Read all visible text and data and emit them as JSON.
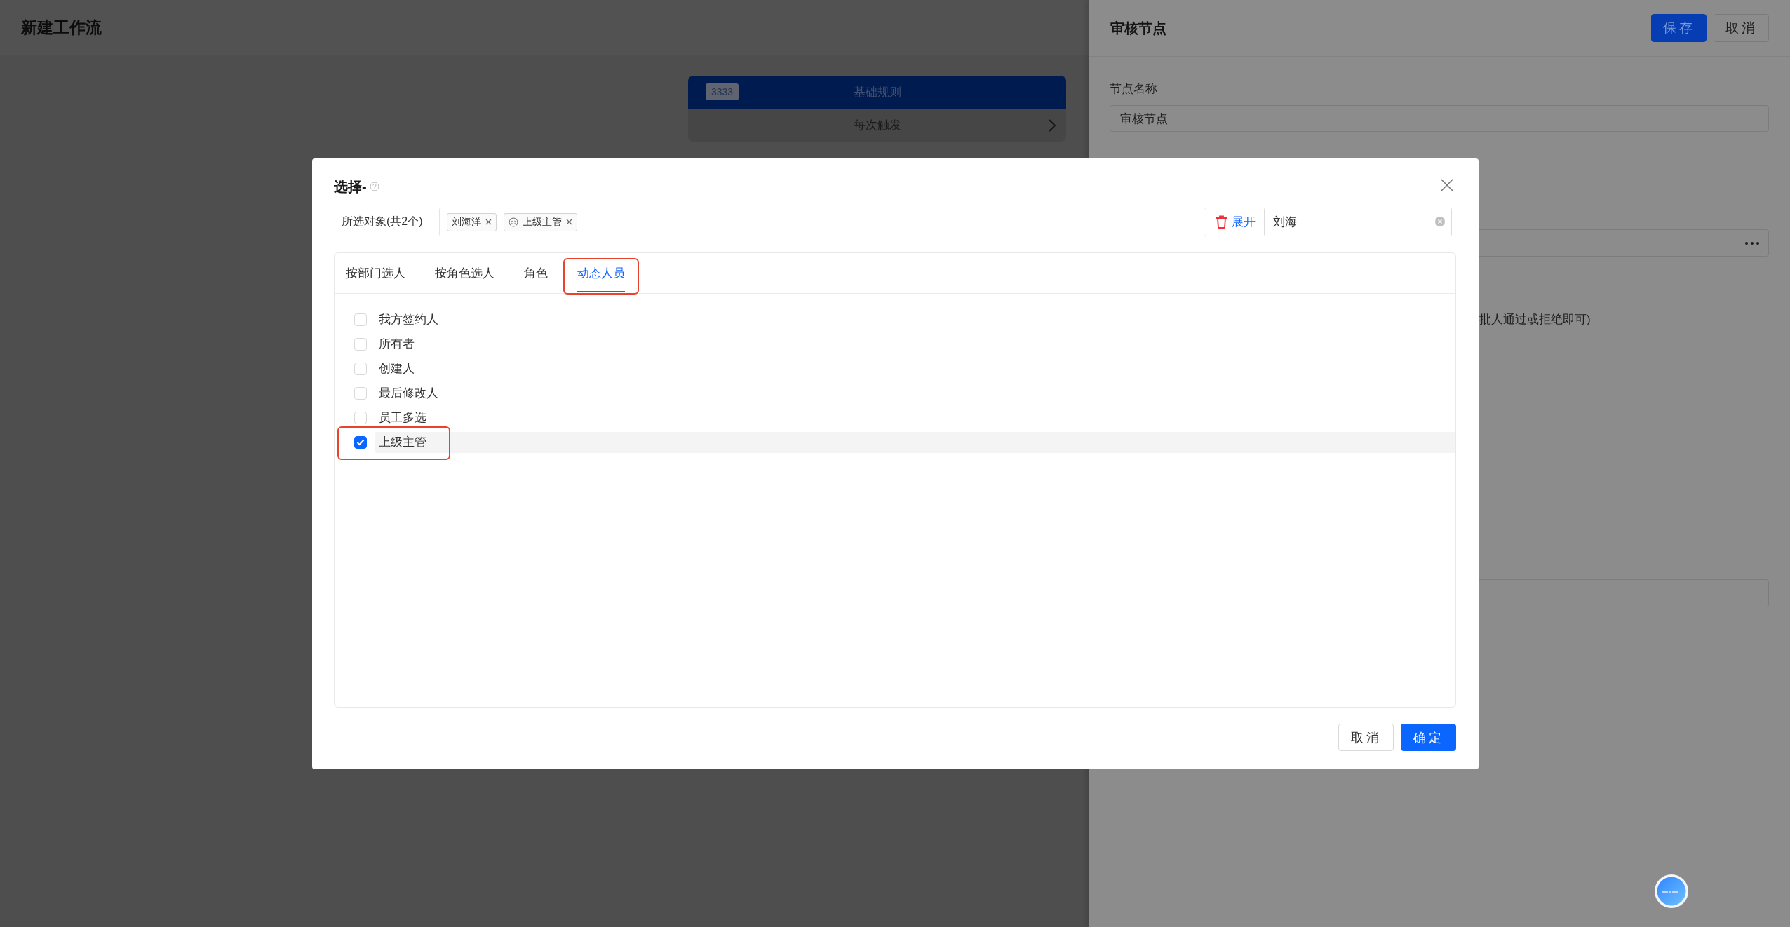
{
  "page": {
    "title": "新建工作流"
  },
  "flow_node": {
    "badge": "3333",
    "title": "基础规则",
    "trigger": "每次触发"
  },
  "drawer": {
    "title": "审核节点",
    "buttons": [
      {
        "label": "保存",
        "kind": "primary"
      },
      {
        "label": "取消",
        "kind": "default"
      }
    ],
    "name_label": "节点名称",
    "name_value": "审核节点",
    "note": "批人通过或拒绝即可)"
  },
  "dialog": {
    "title": "选择-",
    "selected_label": "所选对象(共2个)",
    "selected": [
      {
        "label": "刘海洋",
        "kind": "person"
      },
      {
        "label": "上级主管",
        "kind": "dynamic"
      }
    ],
    "expand_link": "展开",
    "search": {
      "value": "刘海"
    },
    "tabs": [
      {
        "label": "按部门选人",
        "selected": false,
        "annotated": false
      },
      {
        "label": "按角色选人",
        "selected": false,
        "annotated": false
      },
      {
        "label": "角色",
        "selected": false,
        "annotated": false
      },
      {
        "label": "动态人员",
        "selected": true,
        "annotated": true
      }
    ],
    "options": [
      {
        "label": "我方签约人",
        "checked": false,
        "annotated": false
      },
      {
        "label": "所有者",
        "checked": false,
        "annotated": false
      },
      {
        "label": "创建人",
        "checked": false,
        "annotated": false
      },
      {
        "label": "最后修改人",
        "checked": false,
        "annotated": false
      },
      {
        "label": "员工多选",
        "checked": false,
        "annotated": false
      },
      {
        "label": "上级主管",
        "checked": true,
        "annotated": true
      }
    ],
    "buttons": [
      {
        "label": "取消",
        "kind": "default"
      },
      {
        "label": "确定",
        "kind": "primary"
      }
    ]
  }
}
